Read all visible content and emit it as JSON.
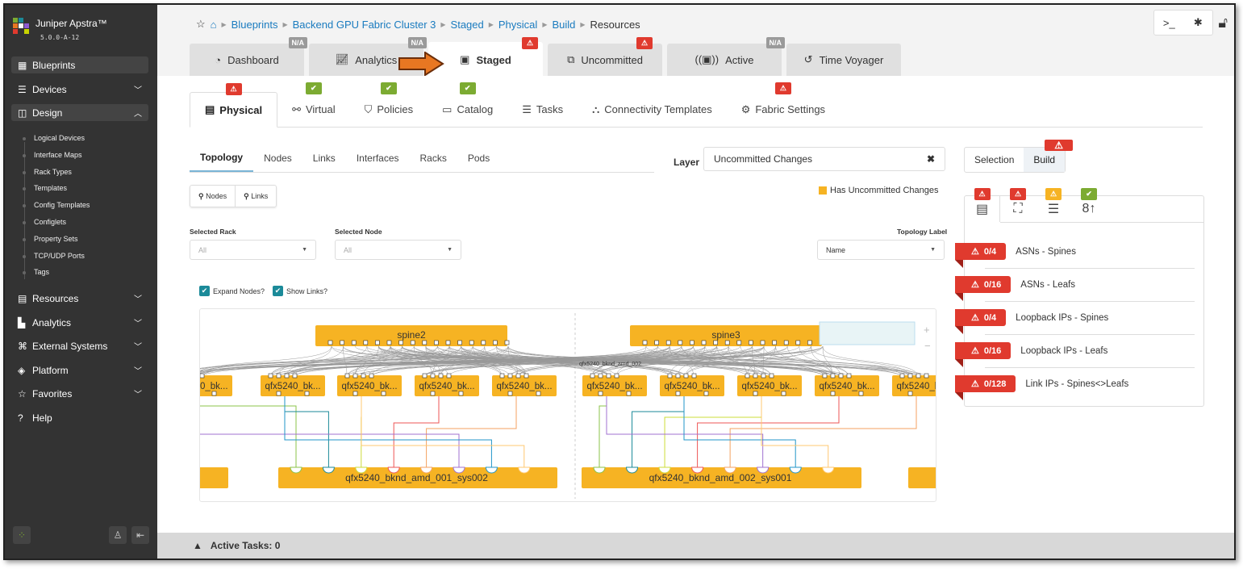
{
  "app": {
    "name": "Juniper Apstra™",
    "version": "5.0.0-A-12"
  },
  "sidebar": {
    "items": [
      {
        "label": "Blueprints",
        "icon": "blueprints-icon",
        "active": true
      },
      {
        "label": "Devices",
        "icon": "devices-icon"
      },
      {
        "label": "Design",
        "icon": "design-icon",
        "expanded": true
      },
      {
        "label": "Resources",
        "icon": "resources-icon"
      },
      {
        "label": "Analytics",
        "icon": "analytics-icon"
      },
      {
        "label": "External Systems",
        "icon": "external-systems-icon"
      },
      {
        "label": "Platform",
        "icon": "platform-icon"
      },
      {
        "label": "Favorites",
        "icon": "star-icon"
      },
      {
        "label": "Help",
        "icon": "help-icon"
      }
    ],
    "design_sub": [
      "Logical Devices",
      "Interface Maps",
      "Rack Types",
      "Templates",
      "Config Templates",
      "Configlets",
      "Property Sets",
      "TCP/UDP Ports",
      "Tags"
    ]
  },
  "breadcrumb": [
    "Blueprints",
    "Backend GPU Fabric Cluster 3",
    "Staged",
    "Physical",
    "Build",
    "Resources"
  ],
  "tabs": [
    {
      "label": "Dashboard",
      "badge": "N/A"
    },
    {
      "label": "Analytics",
      "badge": "N/A"
    },
    {
      "label": "Staged",
      "badge": "⚠"
    },
    {
      "label": "Uncommitted",
      "badge": "⚠"
    },
    {
      "label": "Active",
      "badge": "N/A"
    },
    {
      "label": "Time Voyager"
    }
  ],
  "subtabs": [
    "Physical",
    "Virtual",
    "Policies",
    "Catalog",
    "Tasks",
    "Connectivity Templates",
    "Fabric Settings"
  ],
  "viewtabs": [
    "Topology",
    "Nodes",
    "Links",
    "Interfaces",
    "Racks",
    "Pods"
  ],
  "layer": {
    "label": "Layer",
    "value": "Uncommitted Changes"
  },
  "legend": "Has Uncommitted Changes",
  "search": {
    "nodes": "Nodes",
    "links": "Links"
  },
  "filters": {
    "rack_label": "Selected Rack",
    "rack_value": "All",
    "node_label": "Selected Node",
    "node_value": "All",
    "topo_label": "Topology Label",
    "topo_value": "Name"
  },
  "checks": {
    "expand": "Expand Nodes?",
    "links": "Show Links?"
  },
  "topology": {
    "spines": [
      "spine2",
      "spine3"
    ],
    "leafs": [
      "qfx5240_bk...",
      "qfx5240_bk...",
      "qfx5240_bk...",
      "qfx5240_bk...",
      "qfx5240_bk...",
      "qfx5240_bk...",
      "qfx5240_bk...",
      "qfx5240_bk...",
      "qfx5240_bk...",
      "qfx5240_bk..."
    ],
    "systems": [
      "qfx5240_bknd_amd_001_sys002",
      "qfx5240_bknd_amd_002_sys001"
    ],
    "pod_label": "qfx5240_bknd_amd_002"
  },
  "panel": {
    "selection": "Selection",
    "build": "Build",
    "resources": [
      {
        "count": "0/4",
        "name": "ASNs - Spines"
      },
      {
        "count": "0/16",
        "name": "ASNs - Leafs"
      },
      {
        "count": "0/4",
        "name": "Loopback IPs - Spines"
      },
      {
        "count": "0/16",
        "name": "Loopback IPs - Leafs"
      },
      {
        "count": "0/128",
        "name": "Link IPs - Spines<>Leafs"
      }
    ]
  },
  "footer": {
    "active_tasks": "Active Tasks: 0"
  },
  "colors": {
    "node": "#f6b323",
    "danger": "#e03a2e",
    "ok": "#7cab32",
    "sidebar": "#333333"
  }
}
